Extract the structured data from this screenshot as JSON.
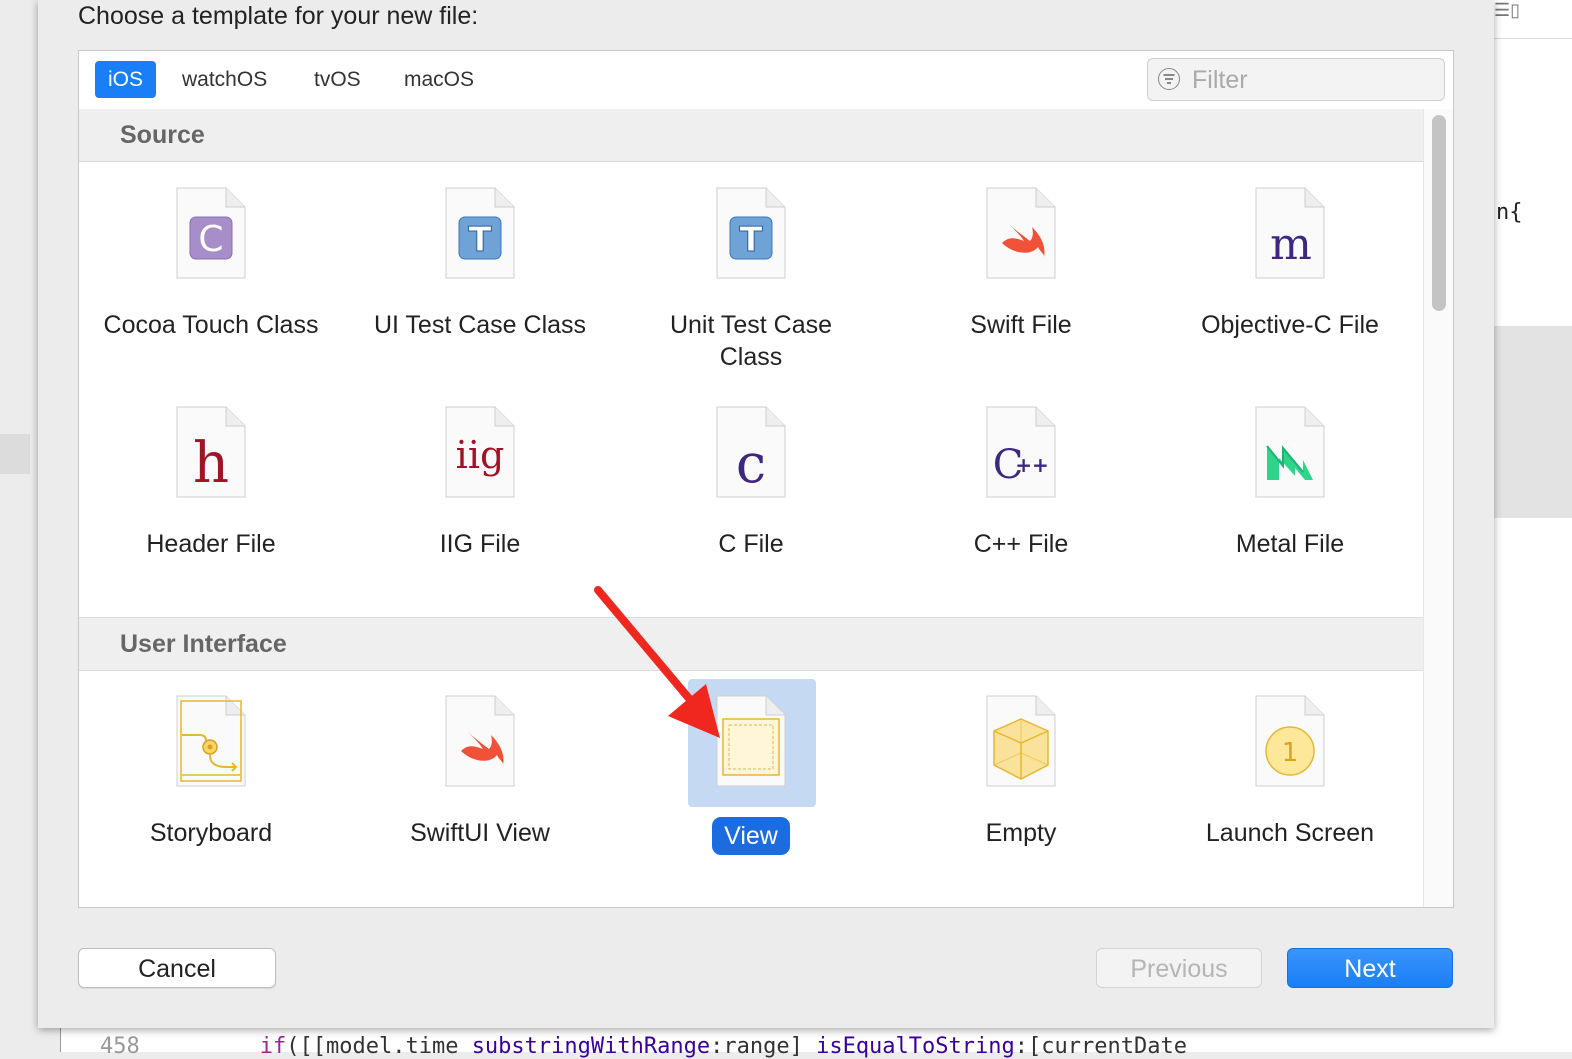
{
  "dialog": {
    "prompt": "Choose a template for your new file:"
  },
  "platform_tabs": [
    {
      "label": "iOS",
      "selected": true
    },
    {
      "label": "watchOS",
      "selected": false
    },
    {
      "label": "tvOS",
      "selected": false
    },
    {
      "label": "macOS",
      "selected": false
    }
  ],
  "filter": {
    "placeholder": "Filter",
    "icon": "filter-icon"
  },
  "sections": [
    {
      "title": "Source",
      "items": [
        {
          "label": "Cocoa Touch Class",
          "icon": "cocoa-touch-class-icon",
          "glyph": "C"
        },
        {
          "label": "UI Test Case Class",
          "icon": "ui-test-case-icon",
          "glyph": "T"
        },
        {
          "label": "Unit Test Case Class",
          "icon": "unit-test-case-icon",
          "glyph": "T"
        },
        {
          "label": "Swift File",
          "icon": "swift-icon"
        },
        {
          "label": "Objective-C File",
          "icon": "objective-c-icon",
          "glyph": "m"
        },
        {
          "label": "Header File",
          "icon": "header-file-icon",
          "glyph": "h"
        },
        {
          "label": "IIG File",
          "icon": "iig-file-icon",
          "glyph": "iig"
        },
        {
          "label": "C File",
          "icon": "c-file-icon",
          "glyph": "c"
        },
        {
          "label": "C++ File",
          "icon": "cpp-file-icon",
          "glyph": "C++"
        },
        {
          "label": "Metal File",
          "icon": "metal-file-icon"
        }
      ]
    },
    {
      "title": "User Interface",
      "items": [
        {
          "label": "Storyboard",
          "icon": "storyboard-icon"
        },
        {
          "label": "SwiftUI View",
          "icon": "swift-icon"
        },
        {
          "label": "View",
          "icon": "view-icon",
          "selected": true
        },
        {
          "label": "Empty",
          "icon": "empty-cube-icon"
        },
        {
          "label": "Launch Screen",
          "icon": "launch-screen-icon",
          "glyph": "1"
        }
      ]
    }
  ],
  "buttons": {
    "cancel": "Cancel",
    "previous": "Previous",
    "next": "Next"
  },
  "background": {
    "code_right": "n{",
    "code_bottom_line": "458",
    "code_bottom_kw": "if",
    "code_bottom_a": "([[model.time ",
    "code_bottom_fn": "substringWithRange",
    "code_bottom_b": ":range] ",
    "code_bottom_fn2": "isEqualToString",
    "code_bottom_c": ":[currentDate"
  },
  "colors": {
    "accent": "#1a7ff7",
    "selection": "#c6d9f3",
    "annotation_arrow": "#f0271e"
  }
}
